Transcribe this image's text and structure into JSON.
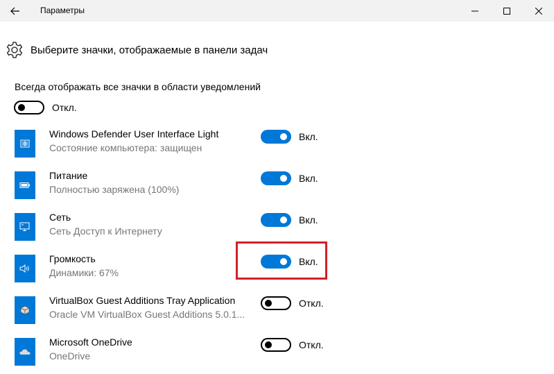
{
  "window": {
    "title": "Параметры"
  },
  "header": {
    "title": "Выберите значки, отображаемые в панели задач"
  },
  "always_show": {
    "label": "Всегда отображать все значки в области уведомлений",
    "state": "Откл."
  },
  "items": [
    {
      "name": "Windows Defender User Interface Light",
      "desc": "Состояние компьютера: защищен",
      "state": "Вкл.",
      "on": true,
      "icon": "defender-icon"
    },
    {
      "name": "Питание",
      "desc": "Полностью заряжена (100%)",
      "state": "Вкл.",
      "on": true,
      "icon": "battery-icon"
    },
    {
      "name": "Сеть",
      "desc": "Сеть Доступ к Интернету",
      "state": "Вкл.",
      "on": true,
      "icon": "network-icon"
    },
    {
      "name": "Громкость",
      "desc": "Динамики: 67%",
      "state": "Вкл.",
      "on": true,
      "icon": "speaker-icon"
    },
    {
      "name": "VirtualBox Guest Additions Tray Application",
      "desc": "Oracle VM VirtualBox Guest Additions 5.0.1...",
      "state": "Откл.",
      "on": false,
      "icon": "virtualbox-icon"
    },
    {
      "name": "Microsoft OneDrive",
      "desc": "OneDrive",
      "state": "Откл.",
      "on": false,
      "icon": "onedrive-icon"
    }
  ],
  "colors": {
    "accent": "#0078d7",
    "highlight": "#d22128",
    "secondary_text": "#767676"
  }
}
